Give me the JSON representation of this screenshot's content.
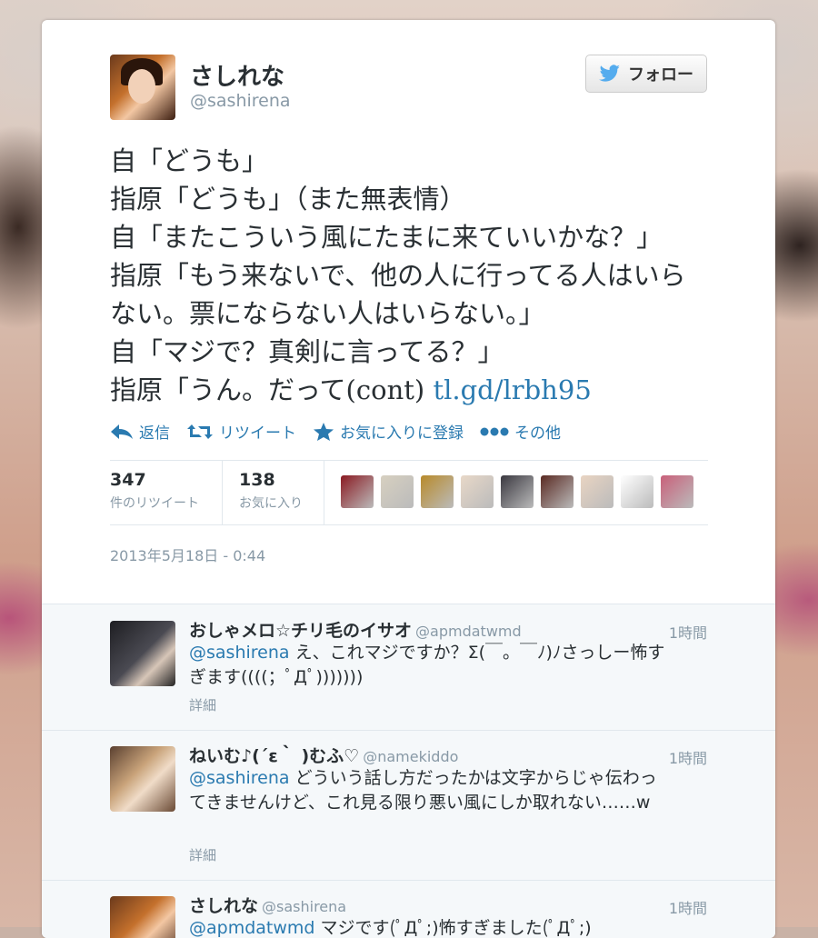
{
  "author": {
    "name": "さしれな",
    "handle": "@sashirena",
    "follow_label": "フォロー"
  },
  "tweet": {
    "text": "自「どうも」\n指原「どうも」（また無表情）\n自「またこういう風にたまに来ていいかな？」\n指原「もう来ないで、他の人に行ってる人はいらない。票にならない人はいらない。」\n自「マジで？真剣に言ってる？」\n指原「うん。だって(cont) ",
    "link": "tl.gd/lrbh95"
  },
  "actions": {
    "reply": "返信",
    "retweet": "リツイート",
    "favorite": "お気に入りに登録",
    "more": "その他"
  },
  "stats": {
    "retweets": "347",
    "retweets_label": "件のリツイート",
    "favorites": "138",
    "favorites_label": "お気に入り"
  },
  "favoriters": [
    {
      "icon": "avatar-red",
      "color": "#8a1a22"
    },
    {
      "icon": "avatar-bride",
      "color": "#d7d0c0"
    },
    {
      "icon": "avatar-bear",
      "color": "#b88a2a"
    },
    {
      "icon": "avatar-girl",
      "color": "#e8d8c8"
    },
    {
      "icon": "avatar-couple",
      "color": "#3a3840"
    },
    {
      "icon": "avatar-dark",
      "color": "#5a2a22"
    },
    {
      "icon": "avatar-light",
      "color": "#e9d4c2"
    },
    {
      "icon": "avatar-drawn-face",
      "color": "#ffffff"
    },
    {
      "icon": "avatar-glasses",
      "color": "#c9607a"
    }
  ],
  "date": "2013年5月18日 - 0:44",
  "replies": [
    {
      "name": "おしゃメロ☆チリ毛のイサオ",
      "handle": "@apmdatwmd",
      "time": "1時間",
      "mention": "@sashirena",
      "text": " え、これマジですか？Σ(￣。￣ﾉ)ﾉさっしー怖すぎます((((；ﾟДﾟ)))))))",
      "detail": "詳細"
    },
    {
      "name": "ねいむ♪(´ε｀ )むふ♡",
      "handle": "@namekiddo",
      "time": "1時間",
      "mention": "@sashirena",
      "text": " どういう話し方だったかは文字からじゃ伝わってきませんけど、これ見る限り悪い風にしか取れない……w",
      "detail": "詳細"
    },
    {
      "name": "さしれな",
      "handle": "@sashirena",
      "time": "1時間",
      "mention": "@apmdatwmd",
      "text": " マジです(ﾟДﾟ;)怖すぎました(ﾟДﾟ;)",
      "detail": ""
    }
  ],
  "colors": {
    "link": "#2a7ab0",
    "muted": "#8899a6",
    "text": "#292f33"
  }
}
